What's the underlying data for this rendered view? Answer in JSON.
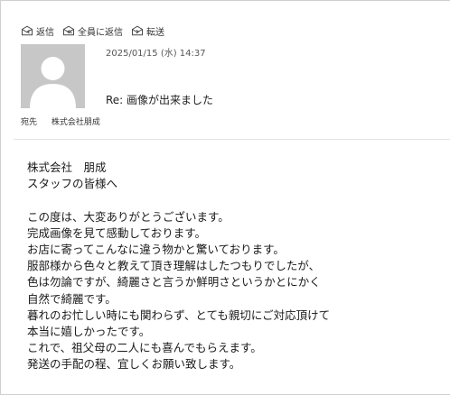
{
  "toolbar": {
    "reply_label": "返信",
    "reply_all_label": "全員に返信",
    "forward_label": "転送",
    "icons": [
      "reply-icon",
      "reply-all-icon",
      "forward-icon"
    ]
  },
  "message": {
    "date": "2025/01/15 (水) 14:37",
    "subject": "Re: 画像が出来ました",
    "to_label": "宛先",
    "to_name": "株式会社朋成"
  },
  "body": {
    "lines": [
      "株式会社　朋成",
      "スタッフの皆様へ",
      "",
      "この度は、大変ありがとうございます。",
      "完成画像を見て感動しております。",
      "お店に寄ってこんなに違う物かと驚いております。",
      "服部様から色々と教えて頂き理解はしたつもりでしたが、",
      "色は勿論ですが、綺麗さと言うか鮮明さというかとにかく",
      "自然で綺麗です。",
      "暮れのお忙しい時にも関わらず、とても親切にご対応頂けて",
      "本当に嬉しかったです。",
      "これで、祖父母の二人にも喜んでもらえます。",
      "発送の手配の程、宜しくお願い致します。"
    ]
  },
  "colors": {
    "avatar_bg": "#c7c7c7",
    "avatar_fg": "#ffffff",
    "icon": "#4a4a4a"
  }
}
